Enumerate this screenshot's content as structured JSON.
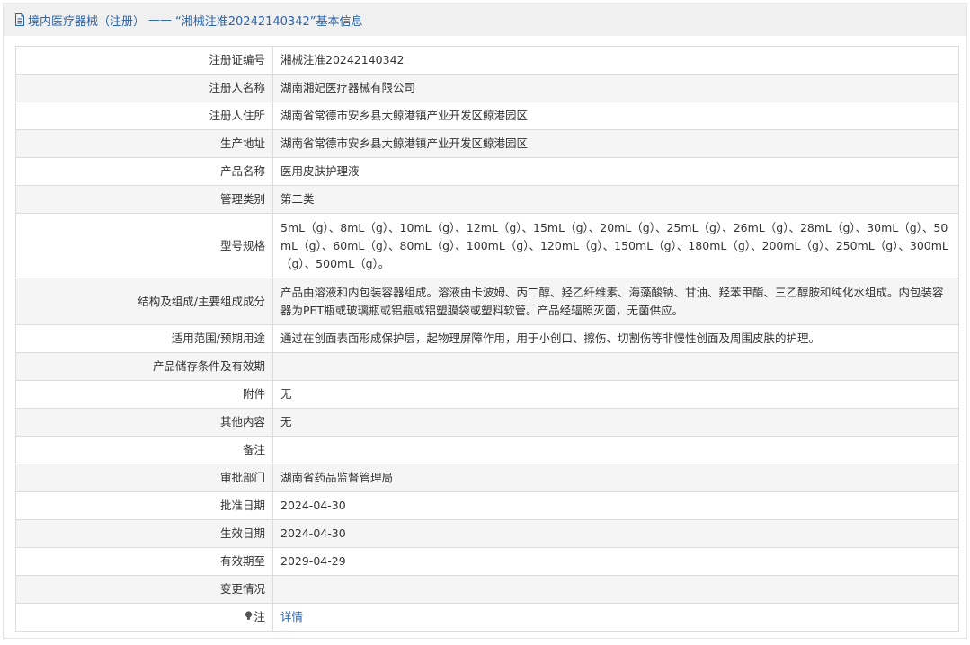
{
  "header": {
    "category": "境内医疗器械（注册）",
    "separator": "——",
    "title": "“湘械注准20242140342”基本信息"
  },
  "rows": [
    {
      "label": "注册证编号",
      "value": "湘械注准20242140342"
    },
    {
      "label": "注册人名称",
      "value": "湖南湘妃医疗器械有限公司"
    },
    {
      "label": "注册人住所",
      "value": "湖南省常德市安乡县大鲸港镇产业开发区鲸港园区"
    },
    {
      "label": "生产地址",
      "value": "湖南省常德市安乡县大鲸港镇产业开发区鲸港园区"
    },
    {
      "label": "产品名称",
      "value": "医用皮肤护理液"
    },
    {
      "label": "管理类别",
      "value": "第二类"
    },
    {
      "label": "型号规格",
      "value": "5mL（g）、8mL（g）、10mL（g）、12mL（g）、15mL（g）、20mL（g）、25mL（g）、26mL（g）、28mL（g）、30mL（g）、50mL（g）、60mL（g）、80mL（g）、100mL（g）、120mL（g）、150mL（g）、180mL（g）、200mL（g）、250mL（g）、300mL（g）、500mL（g）。"
    },
    {
      "label": "结构及组成/主要组成成分",
      "value": "产品由溶液和内包装容器组成。溶液由卡波姆、丙二醇、羟乙纤维素、海藻酸钠、甘油、羟苯甲酯、三乙醇胺和纯化水组成。内包装容器为PET瓶或玻璃瓶或铝瓶或铝塑膜袋或塑料软管。产品经辐照灭菌，无菌供应。"
    },
    {
      "label": "适用范围/预期用途",
      "value": "通过在创面表面形成保护层，起物理屏障作用，用于小创口、擦伤、切割伤等非慢性创面及周围皮肤的护理。"
    },
    {
      "label": "产品储存条件及有效期",
      "value": ""
    },
    {
      "label": "附件",
      "value": "无"
    },
    {
      "label": "其他内容",
      "value": "无"
    },
    {
      "label": "备注",
      "value": ""
    },
    {
      "label": "审批部门",
      "value": "湖南省药品监督管理局"
    },
    {
      "label": "批准日期",
      "value": "2024-04-30"
    },
    {
      "label": "生效日期",
      "value": "2024-04-30"
    },
    {
      "label": "有效期至",
      "value": "2029-04-29"
    },
    {
      "label": "变更情况",
      "value": ""
    },
    {
      "label": "注",
      "value": "详情",
      "icon": "bulb-icon"
    }
  ],
  "colors": {
    "link": "#2c62a5",
    "header_bg": "#f0f0f0",
    "stripe": "#f5f5f5",
    "border": "#dcdcdc"
  }
}
